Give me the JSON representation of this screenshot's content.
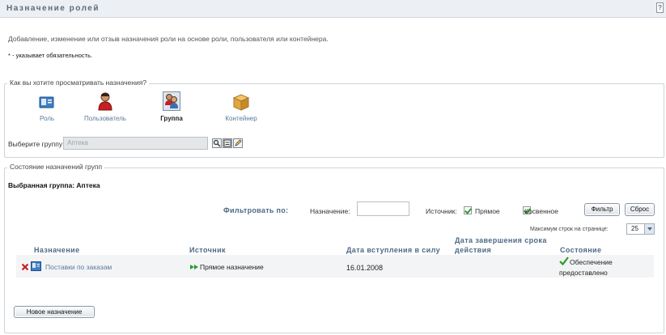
{
  "header": {
    "title": "Назначение ролей",
    "help_label": "?"
  },
  "intro_text": "Добавление, изменение или отзыв назначения роли на основе роли, пользователя или контейнера.",
  "required_note": "* - указывает обязательность.",
  "view_section": {
    "legend": "Как вы хотите просматривать назначения?",
    "types": [
      {
        "label": "Роль",
        "icon": "role-icon"
      },
      {
        "label": "Пользователь",
        "icon": "user-icon"
      },
      {
        "label": "Группа",
        "icon": "group-icon"
      },
      {
        "label": "Контейнер",
        "icon": "container-icon"
      }
    ],
    "active_type": "Группа",
    "select_label": "Выберите группу:",
    "select_value": "Аптека"
  },
  "status_section": {
    "legend": "Состояние назначений групп",
    "selected_group": "Выбранная группа: Аптека",
    "filter_label": "Фильтровать по:",
    "assignment_label": "Назначение:",
    "assignment_value": "",
    "source_label": "Источник:",
    "direct_label": "Прямое",
    "indirect_label": "Косвенное",
    "filter_button": "Фильтр",
    "reset_button": "Сброс",
    "max_rows_label": "Максимум строк на странице:",
    "max_rows_value": "25",
    "columns": {
      "assignment": "Назначение",
      "source": "Источник",
      "start": "Дата вступления в силу",
      "end_line1": "Дата завершения срока",
      "end_line2": "действия",
      "status": "Состояние"
    },
    "rows": [
      {
        "assignment": "Поставки по заказам",
        "source": "Прямое назначение",
        "start": "16.01.2008",
        "end": "",
        "status_line1": "Обеспечение",
        "status_line2": "предоставлено"
      }
    ],
    "new_button": "Новое назначение"
  },
  "colors": {
    "link": "#5a7a9a",
    "header_text": "#4e6a87",
    "check": "#2b9b2b",
    "delete": "#cc1f1f"
  }
}
